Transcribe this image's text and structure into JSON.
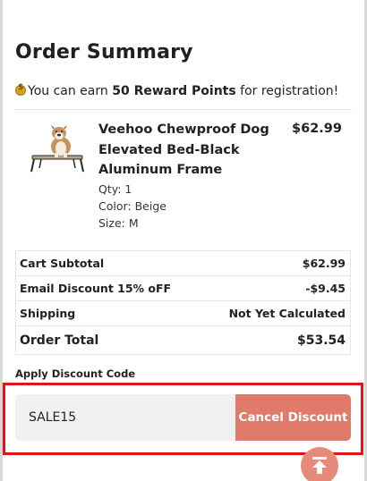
{
  "summary": {
    "title": "Order Summary",
    "reward_prefix": "You can earn ",
    "reward_points": "50 Reward Points",
    "reward_suffix": " for registration!"
  },
  "product": {
    "name": "Veehoo Chewproof Dog Elevated Bed-Black Aluminum Frame",
    "price": "$62.99",
    "qty": "Qty: 1",
    "color": "Color: Beige",
    "size": "Size: M"
  },
  "totals": [
    {
      "label": "Cart Subtotal",
      "value": "$62.99"
    },
    {
      "label": "Email Discount 15% oFF",
      "value": "-$9.45"
    },
    {
      "label": "Shipping",
      "value": "Not Yet Calculated"
    },
    {
      "label": "Order Total",
      "value": "$53.54"
    }
  ],
  "discount": {
    "label": "Apply Discount Code",
    "code": "SALE15",
    "cancel_label": "Cancel Discount"
  },
  "colors": {
    "accent": "#e07a6a",
    "highlight": "#e0141c",
    "coin": "#d8a21f"
  },
  "icons": {
    "coin": "coin-icon",
    "scroll_top": "arrow-up-to-top-icon"
  }
}
